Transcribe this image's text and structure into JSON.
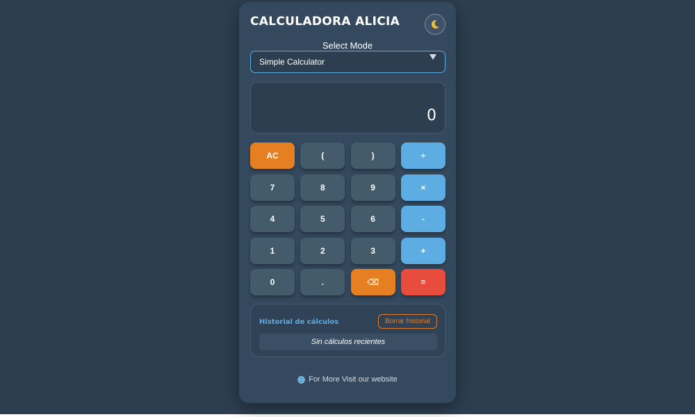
{
  "app": {
    "title": "CALCULADORA ALICIA",
    "theme_icon": "moon-icon"
  },
  "mode": {
    "label": "Select Mode",
    "selected": "Simple Calculator"
  },
  "display": {
    "value": "0"
  },
  "keys": [
    {
      "label": "AC",
      "kind": "accent"
    },
    {
      "label": "(",
      "kind": "num"
    },
    {
      "label": ")",
      "kind": "num"
    },
    {
      "label": "÷",
      "kind": "op"
    },
    {
      "label": "7",
      "kind": "num"
    },
    {
      "label": "8",
      "kind": "num"
    },
    {
      "label": "9",
      "kind": "num"
    },
    {
      "label": "×",
      "kind": "op"
    },
    {
      "label": "4",
      "kind": "num"
    },
    {
      "label": "5",
      "kind": "num"
    },
    {
      "label": "6",
      "kind": "num"
    },
    {
      "label": "-",
      "kind": "op"
    },
    {
      "label": "1",
      "kind": "num"
    },
    {
      "label": "2",
      "kind": "num"
    },
    {
      "label": "3",
      "kind": "num"
    },
    {
      "label": "+",
      "kind": "op"
    },
    {
      "label": "0",
      "kind": "num"
    },
    {
      "label": ".",
      "kind": "num"
    },
    {
      "label": "⌫",
      "kind": "accent"
    },
    {
      "label": "=",
      "kind": "eq"
    }
  ],
  "history": {
    "title": "Historial de cálculos",
    "clear_label": "Borrar historial",
    "empty_text": "Sin cálculos recientes"
  },
  "footer": {
    "link_text": "For More Visit our website",
    "icon": "globe-icon"
  },
  "colors": {
    "background": "#2c3e50",
    "card": "#34495e",
    "operator": "#5dade2",
    "accent": "#e67e22",
    "equals": "#e74c3c",
    "number_key": "#435b6b"
  }
}
